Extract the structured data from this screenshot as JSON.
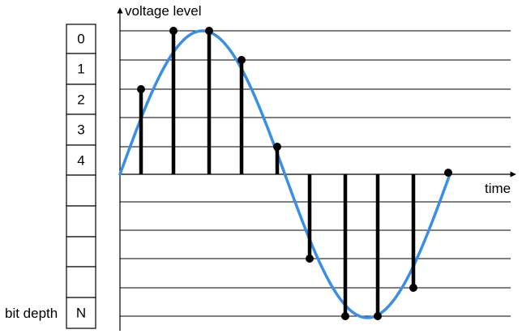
{
  "labels": {
    "y_axis": "voltage level",
    "x_axis": "time",
    "bit_depth": "bit depth"
  },
  "levels": [
    "0",
    "1",
    "2",
    "3",
    "4",
    "",
    "",
    "",
    "",
    "N"
  ],
  "colors": {
    "wave": "#3a8ee6",
    "lines": "#000000"
  }
}
